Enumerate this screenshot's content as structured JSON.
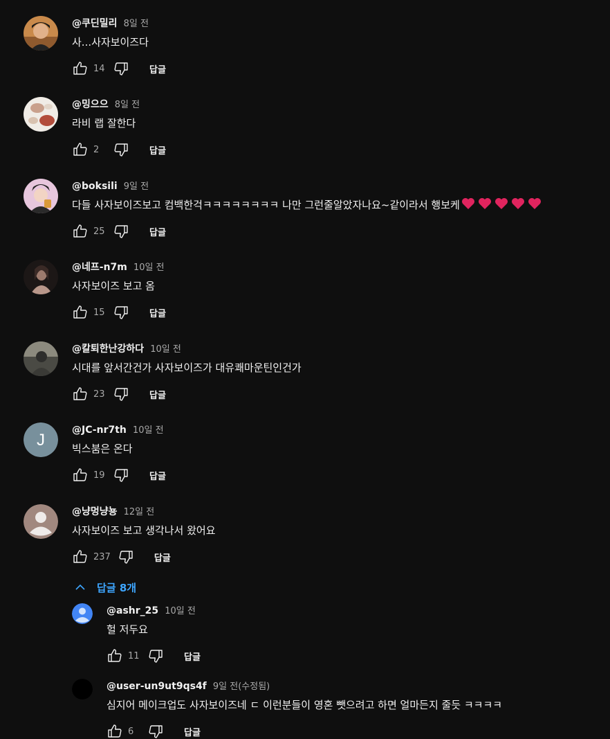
{
  "comments": [
    {
      "author": "@쿠딘밀리",
      "time": "8일 전",
      "text": "사...사자보이즈다",
      "likes": "14",
      "reply_label": "답글",
      "avatar": "photo-person"
    },
    {
      "author": "@밍으으",
      "time": "8일 전",
      "text": "라비 랩 잘한다",
      "likes": "2",
      "reply_label": "답글",
      "avatar": "photo-food"
    },
    {
      "author": "@boksili",
      "time": "9일 전",
      "text": "다들 사자보이즈보고 컴백한걱ㅋㅋㅋㅋㅋㅋㅋㅋ 나만 그런줄알았자나요~같이라서 행보케",
      "hearts": 5,
      "likes": "25",
      "reply_label": "답글",
      "avatar": "photo-pink"
    },
    {
      "author": "@네프-n7m",
      "time": "10일 전",
      "text": "사자보이즈 보고 옴",
      "likes": "15",
      "reply_label": "답글",
      "avatar": "photo-dark"
    },
    {
      "author": "@칼퇴한난강하다",
      "time": "10일 전",
      "text": "시대를 앞서간건가 사자보이즈가 대유쾌마운틴인건가",
      "likes": "23",
      "reply_label": "답글",
      "avatar": "photo-grey"
    },
    {
      "author": "@JC-nr7th",
      "time": "10일 전",
      "text": "빅스붐은 온다",
      "likes": "19",
      "reply_label": "답글",
      "avatar_letter": "J",
      "avatar_color": "#78909c"
    },
    {
      "author": "@냥멍냥뇽",
      "time": "12일 전",
      "text": "사자보이즈 보고 생각나서 왔어요",
      "likes": "237",
      "reply_label": "답글",
      "avatar": "default-person"
    }
  ],
  "replies_toggle": {
    "label": "답글 8개",
    "icon": "chevron-up-icon",
    "color": "#3ea6ff"
  },
  "replies": [
    {
      "author": "@ashr_25",
      "time": "10일 전",
      "text": "헐 저두요",
      "likes": "11",
      "reply_label": "답글",
      "avatar": "default-person-blue"
    },
    {
      "author": "@user-un9ut9qs4f",
      "time": "9일 전(수정됨)",
      "text": "심지어 메이크업도 사자보이즈네 ㄷ 이런분들이 영혼 뺏으려고 하면 얼마든지 줄듯 ㅋㅋㅋㅋ",
      "likes": "6",
      "reply_label": "답글",
      "avatar": "black-circle"
    }
  ],
  "colors": {
    "background": "#0f0f0f",
    "text": "#f1f1f1",
    "secondary": "#aaaaaa",
    "link": "#3ea6ff",
    "heart": "#e0245e"
  }
}
